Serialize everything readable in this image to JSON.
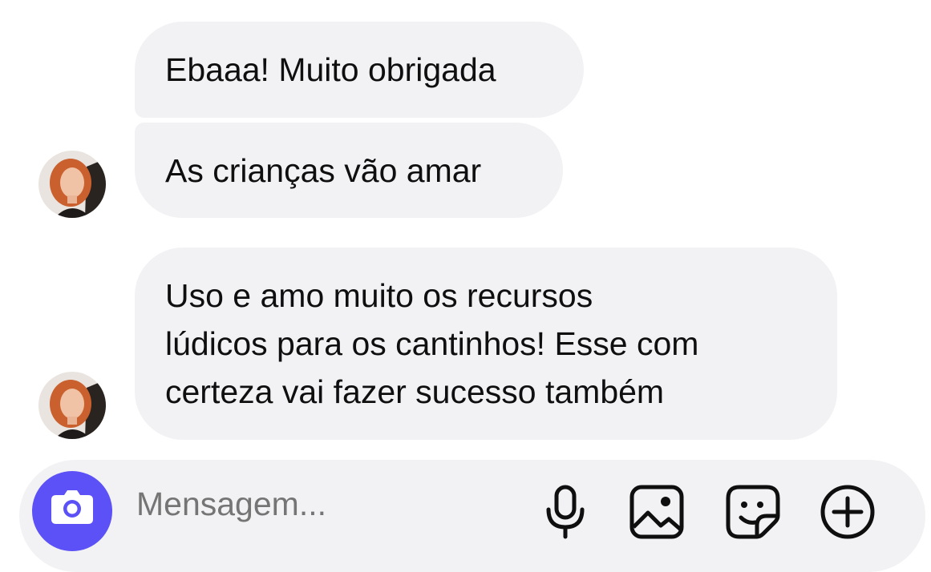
{
  "messages": [
    {
      "text": "Ebaaa! Muito obrigada"
    },
    {
      "text": "As crianças vão amar"
    },
    {
      "lines": [
        "Uso e amo muito os recursos",
        "lúdicos para os cantinhos! Esse com",
        "certeza vai fazer sucesso também"
      ]
    }
  ],
  "composer": {
    "placeholder": "Mensagem...",
    "icons": [
      "camera-icon",
      "microphone-icon",
      "image-icon",
      "sticker-icon",
      "plus-icon"
    ]
  },
  "colors": {
    "bubble": "#f2f2f4",
    "camera_button": "#5b51f6",
    "placeholder": "#7a7a80"
  }
}
